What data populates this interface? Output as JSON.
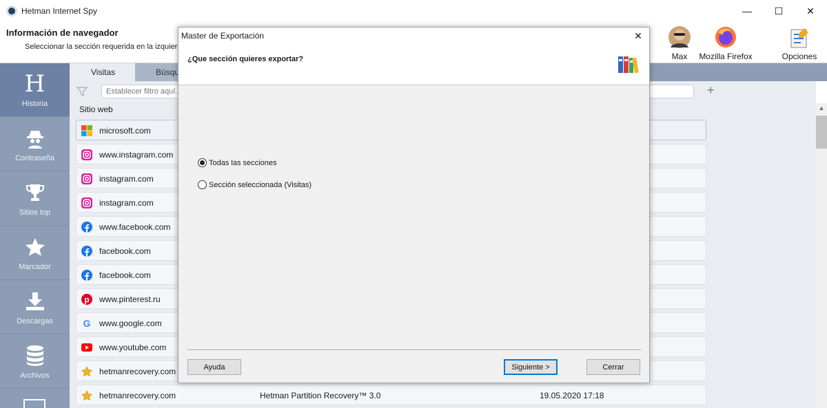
{
  "window": {
    "title": "Hetman Internet Spy",
    "minimize": "—",
    "maximize": "☐",
    "close": "✕"
  },
  "header": {
    "title": "Información de navegador",
    "subtitle": "Seleccionar la sección requerida en la izquierda",
    "buttons": [
      {
        "label": "Max",
        "icon": "user-avatar-icon"
      },
      {
        "label": "Mozilla Firefox",
        "icon": "firefox-icon"
      },
      {
        "label": "Opciones",
        "icon": "options-icon"
      }
    ]
  },
  "sidebar": {
    "items": [
      {
        "label": "Historia",
        "icon": "history-h-icon",
        "active": true
      },
      {
        "label": "Contraseña",
        "icon": "spy-icon"
      },
      {
        "label": "Sitios top",
        "icon": "trophy-icon"
      },
      {
        "label": "Marcador",
        "icon": "star-icon"
      },
      {
        "label": "Descargas",
        "icon": "download-icon"
      },
      {
        "label": "Archivos",
        "icon": "database-icon"
      }
    ]
  },
  "tabs": [
    {
      "label": "Visitas"
    },
    {
      "label": "Búsque"
    }
  ],
  "filter": {
    "placeholder": "Establecer filtro aquí..."
  },
  "table": {
    "col_site": "Sitio web",
    "rows": [
      {
        "site": "microsoft.com",
        "icon": "microsoft-icon",
        "title": "",
        "date": ""
      },
      {
        "site": "www.instagram.com",
        "icon": "instagram-icon",
        "title": "",
        "date": ""
      },
      {
        "site": "instagram.com",
        "icon": "instagram-icon",
        "title": "",
        "date": ""
      },
      {
        "site": "instagram.com",
        "icon": "instagram-icon",
        "title": "",
        "date": ""
      },
      {
        "site": "www.facebook.com",
        "icon": "facebook-icon",
        "title": "",
        "date": ""
      },
      {
        "site": "facebook.com",
        "icon": "facebook-icon",
        "title": "",
        "date": ""
      },
      {
        "site": "facebook.com",
        "icon": "facebook-icon",
        "title": "",
        "date": ""
      },
      {
        "site": "www.pinterest.ru",
        "icon": "pinterest-icon",
        "title": "",
        "date": ""
      },
      {
        "site": "www.google.com",
        "icon": "google-icon",
        "title": "",
        "date": ""
      },
      {
        "site": "www.youtube.com",
        "icon": "youtube-icon",
        "title": "",
        "date": ""
      },
      {
        "site": "hetmanrecovery.com",
        "icon": "star-fav-icon",
        "title": "",
        "date": ""
      },
      {
        "site": "hetmanrecovery.com",
        "icon": "star-fav-icon",
        "title": "Hetman Partition Recovery™ 3.0",
        "date": "19.05.2020 17:18"
      }
    ]
  },
  "dialog": {
    "title": "Master de Exportación",
    "close": "✕",
    "question": "¿Que sección quieres exportar?",
    "options": [
      {
        "label": "Todas las secciones",
        "selected": true
      },
      {
        "label": "Sección seleccionada (Visitas)",
        "selected": false
      }
    ],
    "buttons": {
      "help": "Ayuda",
      "next": "Siguiente >",
      "close": "Cerrar"
    }
  },
  "colors": {
    "sidebar": "#8c9db5",
    "sidebar_active": "#6c81a3",
    "content_bg": "#e9edf2",
    "accent": "#0078d7"
  }
}
